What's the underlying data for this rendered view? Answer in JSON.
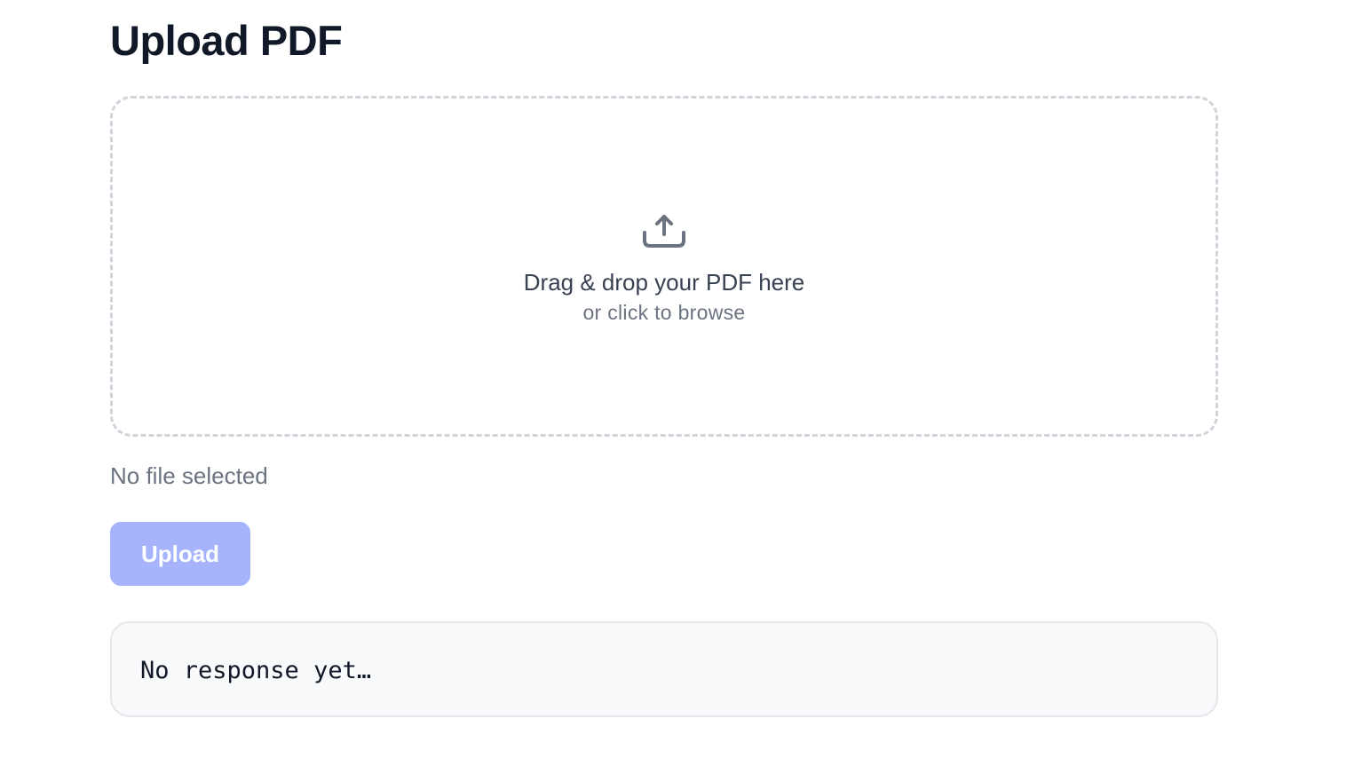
{
  "page": {
    "title": "Upload PDF"
  },
  "dropzone": {
    "icon": "upload-tray-icon",
    "primary_text": "Drag & drop your PDF here",
    "secondary_text": "or click to browse"
  },
  "file_status": {
    "text": "No file selected"
  },
  "upload_button": {
    "label": "Upload",
    "disabled": true
  },
  "response": {
    "text": "No response yet…"
  },
  "colors": {
    "title": "#111827",
    "dropzone_border": "#d1d5db",
    "dropzone_primary": "#374151",
    "muted_text": "#6b7280",
    "button_disabled_bg": "#a5b4fc",
    "button_text": "#ffffff",
    "response_bg": "#f9fafb",
    "response_border": "#e5e7eb"
  }
}
